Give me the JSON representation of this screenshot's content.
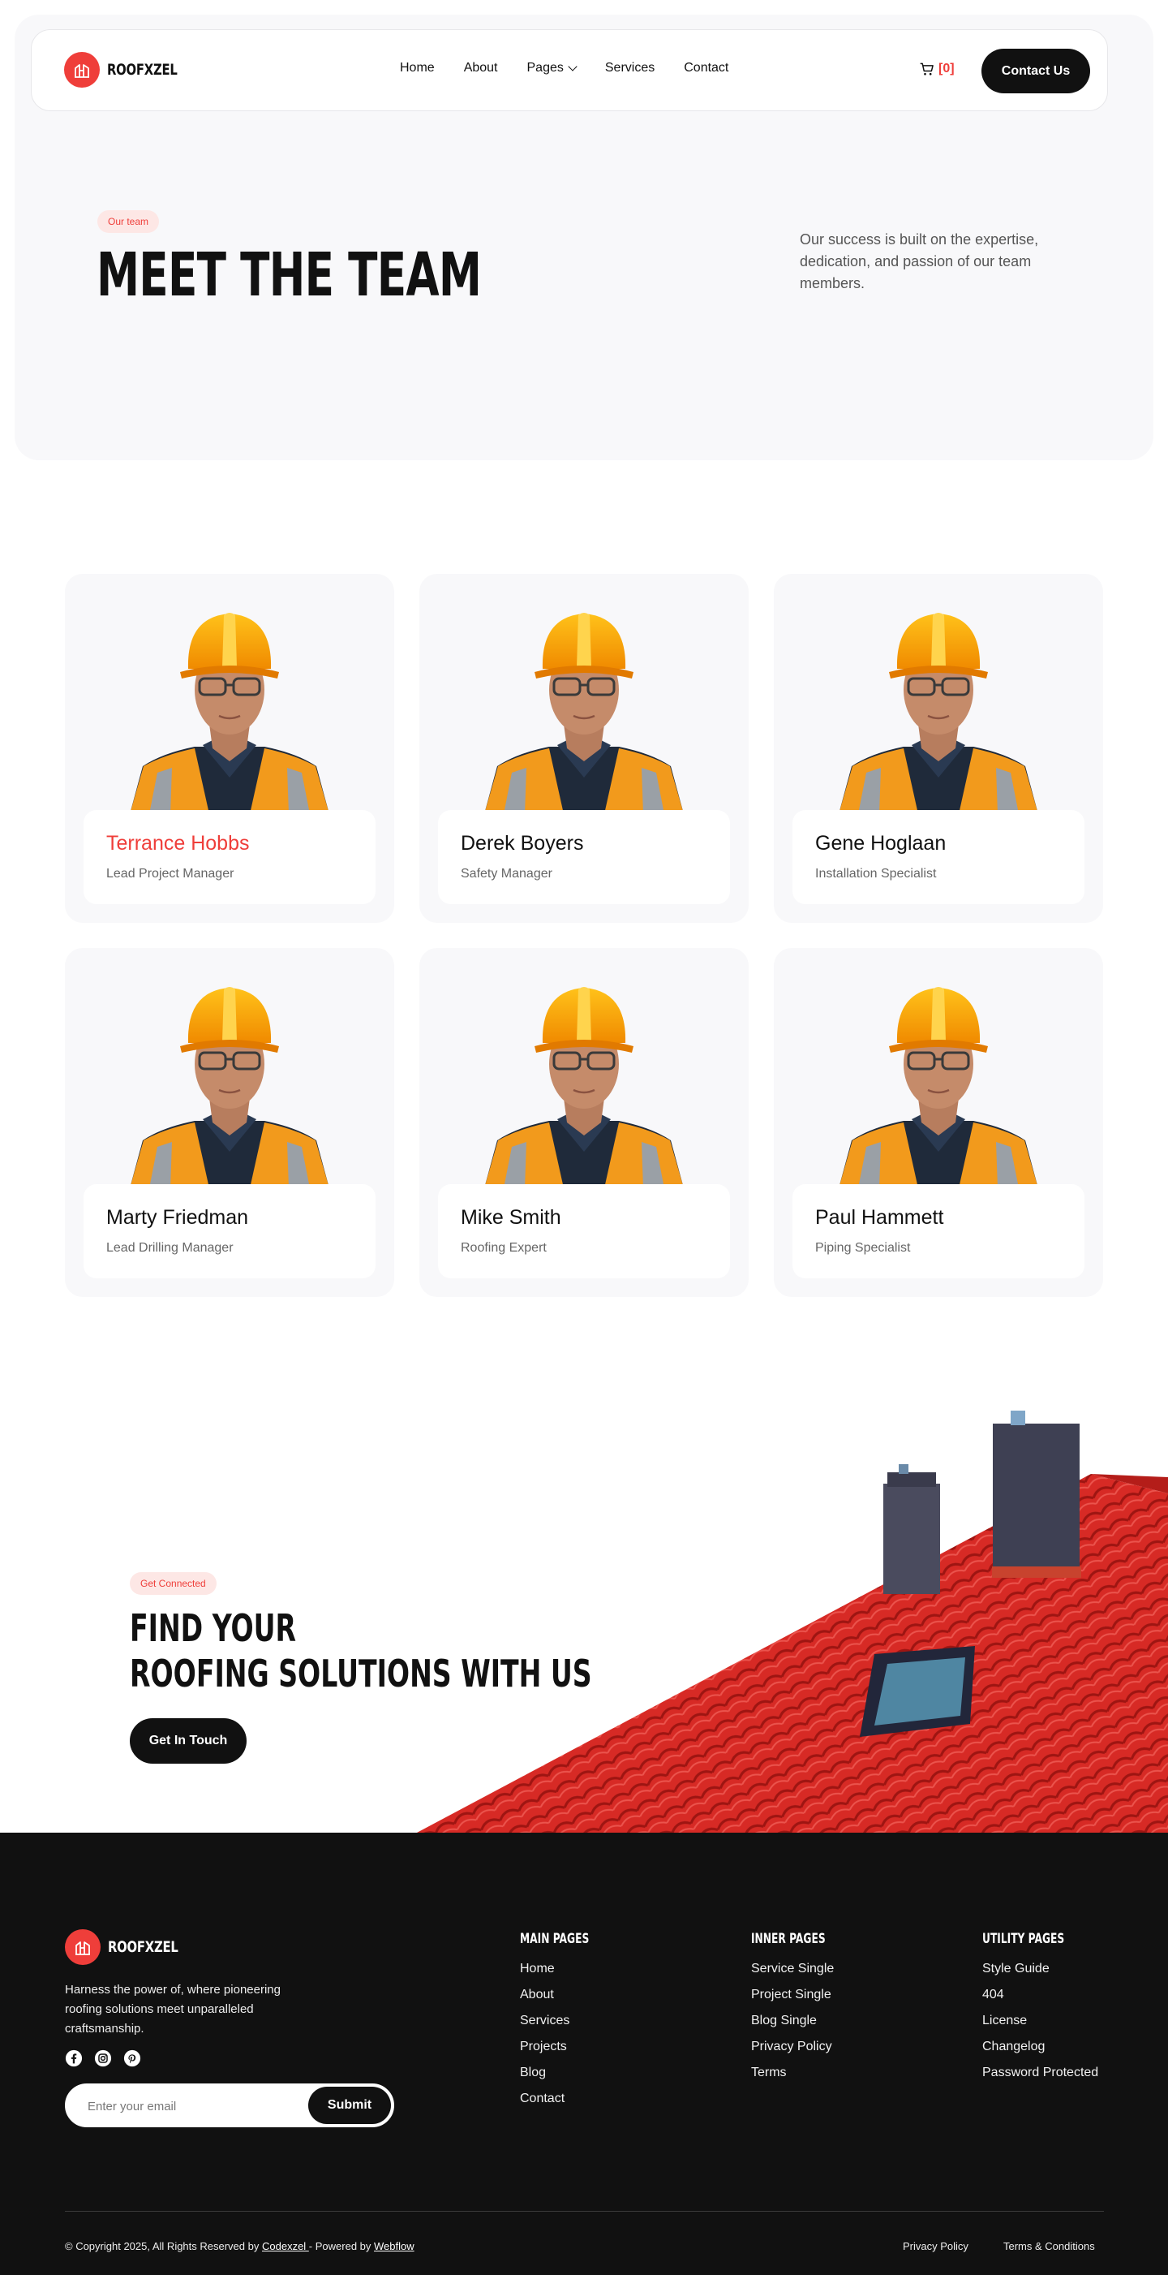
{
  "brand": {
    "name": "ROOFXZEL",
    "accent": "#ef3e3a"
  },
  "nav": {
    "links": [
      "Home",
      "About",
      "Pages",
      "Services",
      "Contact"
    ],
    "cart_count": "[0]",
    "contact_label": "Contact Us"
  },
  "hero": {
    "tag": "Our team",
    "title": "MEET THE TEAM",
    "description": "Our success is built on the expertise, dedication, and passion of our team members."
  },
  "team": [
    {
      "name": "Terrance Hobbs",
      "role": "Lead Project Manager"
    },
    {
      "name": "Derek Boyers",
      "role": "Safety Manager"
    },
    {
      "name": "Gene Hoglaan",
      "role": "Installation Specialist"
    },
    {
      "name": "Marty Friedman",
      "role": "Lead Drilling Manager"
    },
    {
      "name": "Mike Smith",
      "role": "Roofing Expert"
    },
    {
      "name": "Paul Hammett",
      "role": "Piping Specialist"
    }
  ],
  "cta": {
    "tag": "Get Connected",
    "title_line1": "FIND YOUR",
    "title_line2": "ROOFING SOLUTIONS WITH US",
    "button": "Get In Touch"
  },
  "footer": {
    "brand": "ROOFXZEL",
    "description": "Harness the power of, where pioneering roofing solutions meet unparalleled craftsmanship.",
    "socials": [
      "facebook-icon",
      "instagram-icon",
      "pinterest-icon"
    ],
    "email_placeholder": "Enter your email",
    "submit": "Submit",
    "columns": [
      {
        "title": "MAIN PAGES",
        "links": [
          "Home",
          "About",
          "Services",
          "Projects",
          "Blog",
          "Contact"
        ]
      },
      {
        "title": "INNER PAGES",
        "links": [
          "Service Single",
          "Project Single",
          "Blog Single",
          "Privacy Policy",
          "Terms"
        ]
      },
      {
        "title": "UTILITY PAGES",
        "links": [
          "Style Guide",
          "404",
          "License",
          "Changelog",
          "Password Protected"
        ]
      }
    ],
    "copyright_prefix": "© Copyright 2025, All Rights Reserved by ",
    "copyright_brand": "Codexzel ",
    "copyright_mid": "- Powered by ",
    "copyright_platform": "Webflow",
    "privacy": "Privacy Policy",
    "terms": "Terms & Conditions"
  }
}
